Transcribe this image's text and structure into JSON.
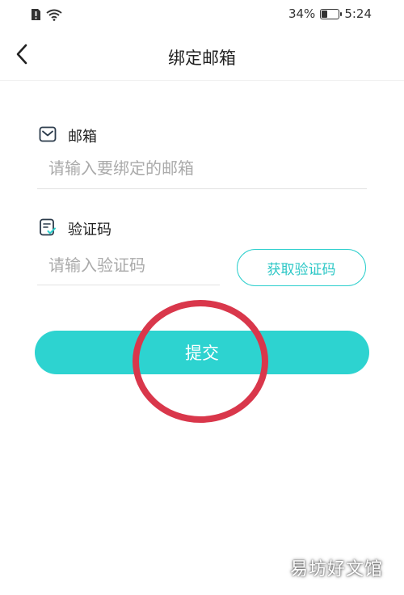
{
  "status_bar": {
    "battery_percent_text": "34%",
    "battery_level": 0.34,
    "time": "5:24",
    "icons": [
      "sim-alert-icon",
      "wifi-icon",
      "battery-icon"
    ]
  },
  "nav": {
    "back_icon": "chevron-left-icon",
    "title": "绑定邮箱"
  },
  "email": {
    "icon": "mail-icon",
    "label": "邮箱",
    "value": "",
    "placeholder": "请输入要绑定的邮箱"
  },
  "code": {
    "icon": "verify-code-icon",
    "label": "验证码",
    "value": "",
    "placeholder": "请输入验证码",
    "get_code_label": "获取验证码"
  },
  "submit": {
    "label": "提交"
  },
  "watermark": {
    "text": "易坊好文馆"
  },
  "colors": {
    "accent": "#2dd3d0",
    "accent_text": "#2bc7c6",
    "annotation": "#d9374b",
    "placeholder": "#aaaaaa"
  }
}
